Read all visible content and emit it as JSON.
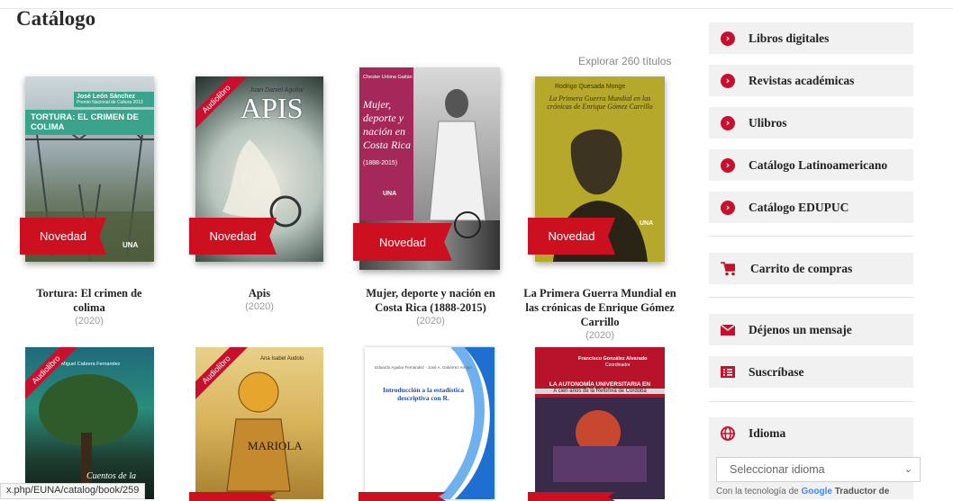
{
  "page": {
    "title": "Catálogo",
    "explore_link": "Explorar 260 títulos"
  },
  "books_row1": [
    {
      "title": "Tortura: El crimen de colima",
      "year": "(2020)",
      "badge": "Novedad",
      "cover_author": "José León Sánchez",
      "cover_subtitle": "Premio Nacional de Cultura 2013",
      "cover_title": "TORTURA: EL CRIMEN DE COLIMA",
      "cover_logo": "UNA"
    },
    {
      "title": "Apis",
      "year": "(2020)",
      "badge": "Novedad",
      "ribbon": "Audiolibro",
      "cover_author": "Juan Daniel Aguilar",
      "cover_title": "APIS"
    },
    {
      "title": "Mujer, deporte y nación en Costa Rica (1888-2015)",
      "year": "(2020)",
      "badge": "Novedad",
      "cover_author": "Chester Urbina Gaitán",
      "cover_title": "Mujer, deporte y nación en Costa Rica",
      "cover_years": "(1888-2015)",
      "cover_logo": "UNA"
    },
    {
      "title": "La Primera Guerra Mundial en las crónicas de Enrique Gómez Carrillo",
      "year": "(2020)",
      "badge": "Novedad",
      "cover_author": "Rodrigo Quesada Monge",
      "cover_title": "La Primera Guerra Mundial en las crónicas de Enrique Gómez Carrillo",
      "cover_logo": "UNA"
    }
  ],
  "books_row2": [
    {
      "ribbon": "Audiolibro",
      "cover_author": "Miguel Cabrera Fernandez",
      "cover_title": "Cuentos de la"
    },
    {
      "ribbon": "Audiolibro",
      "cover_author": "Ana Isabel Audolo",
      "cover_title": "MARIOLA"
    },
    {
      "cover_author": "Eduardo Aguilar Fernández · José A. Gutiérrez Arroyo",
      "cover_title": "Introducción a la estadística descriptiva con R."
    },
    {
      "cover_author": "Francisco González Alvarado",
      "cover_role": "Coordinador",
      "cover_title": "LA AUTONOMÍA UNIVERSITARIA EN DIÁLOGO",
      "cover_subtitle": "A cien años de la Reforma de Córdoba"
    }
  ],
  "sidebar": {
    "items": [
      {
        "label": "Libros digitales"
      },
      {
        "label": "Revistas académicas"
      },
      {
        "label": "Ulibros"
      },
      {
        "label": "Catálogo Latinoamericano"
      },
      {
        "label": "Catálogo EDUPUC"
      }
    ],
    "cart": "Carrito de compras",
    "message": "Déjenos un mensaje",
    "subscribe": "Suscríbase",
    "language": {
      "heading": "Idioma",
      "select_value": "Seleccionar idioma",
      "powered_prefix": "Con la tecnología de",
      "powered_brand": "Google",
      "powered_suffix": "Traductor de"
    }
  },
  "status_url": "x.php/EUNA/catalog/book/259",
  "colors": {
    "accent": "#c8102e",
    "sidebar_bg": "#f1f1f1"
  }
}
